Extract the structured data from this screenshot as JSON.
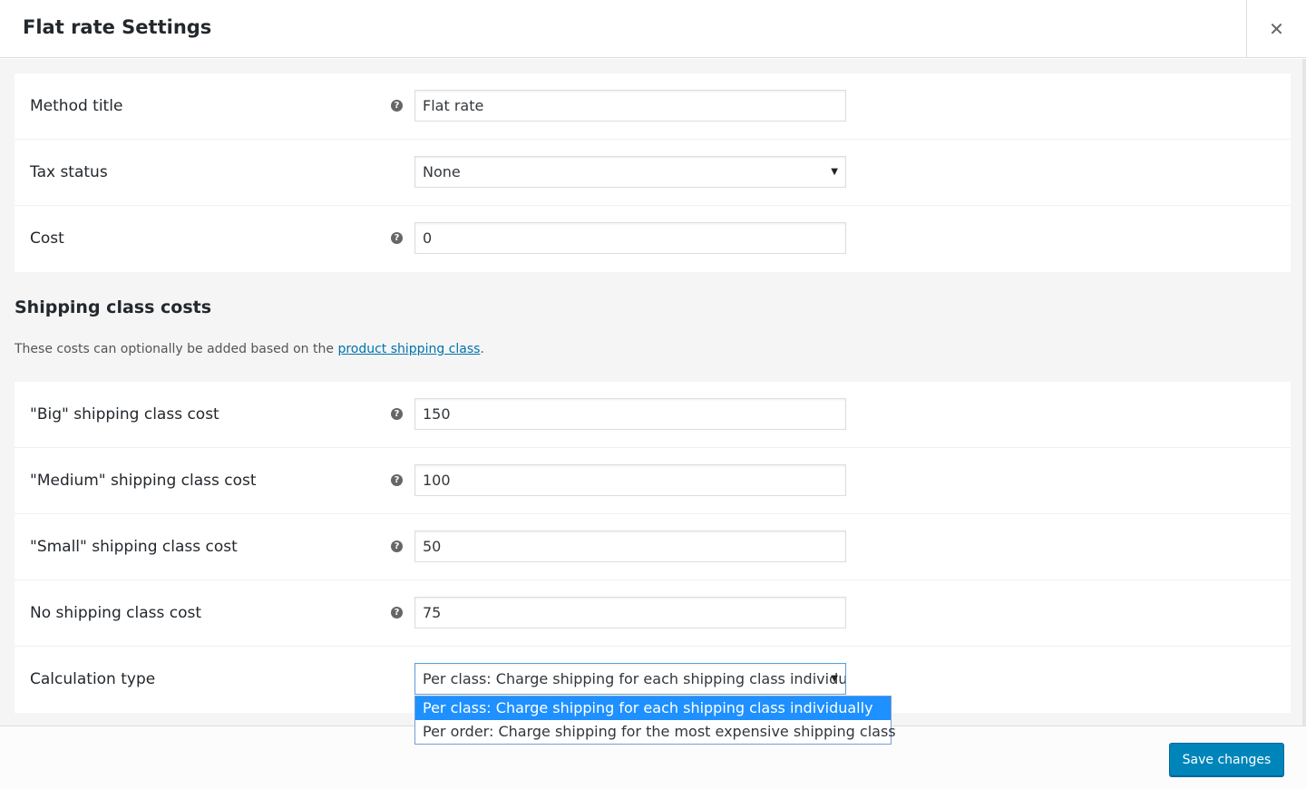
{
  "header": {
    "title": "Flat rate Settings",
    "close_icon": "close-icon",
    "close_glyph": "✕"
  },
  "general": {
    "rows": [
      {
        "label": "Method title",
        "value": "Flat rate",
        "help": "?"
      },
      {
        "label": "Tax status",
        "value": "None",
        "arrow": "▼"
      },
      {
        "label": "Cost",
        "value": "0",
        "help": "?"
      }
    ]
  },
  "shipping_class_section": {
    "heading": "Shipping class costs",
    "desc_prefix": "These costs can optionally be added based on the ",
    "desc_link": "product shipping class",
    "desc_suffix": "."
  },
  "class_costs": {
    "rows": [
      {
        "label": "\"Big\" shipping class cost",
        "value": "150",
        "help": "?"
      },
      {
        "label": "\"Medium\" shipping class cost",
        "value": "100",
        "help": "?"
      },
      {
        "label": "\"Small\" shipping class cost",
        "value": "50",
        "help": "?"
      },
      {
        "label": "No shipping class cost",
        "value": "75",
        "help": "?"
      },
      {
        "label": "Calculation type",
        "value": "Per class: Charge shipping for each shipping class individually",
        "arrow": "▼"
      }
    ]
  },
  "calculation_dropdown": {
    "options": [
      "Per class: Charge shipping for each shipping class individually",
      "Per order: Charge shipping for the most expensive shipping class"
    ]
  },
  "footer": {
    "save_label": "Save changes"
  },
  "colors": {
    "primary_button": "#0085ba",
    "link": "#0073aa",
    "selected_option": "#1e90ff",
    "panel_background": "#f5f5f5"
  }
}
